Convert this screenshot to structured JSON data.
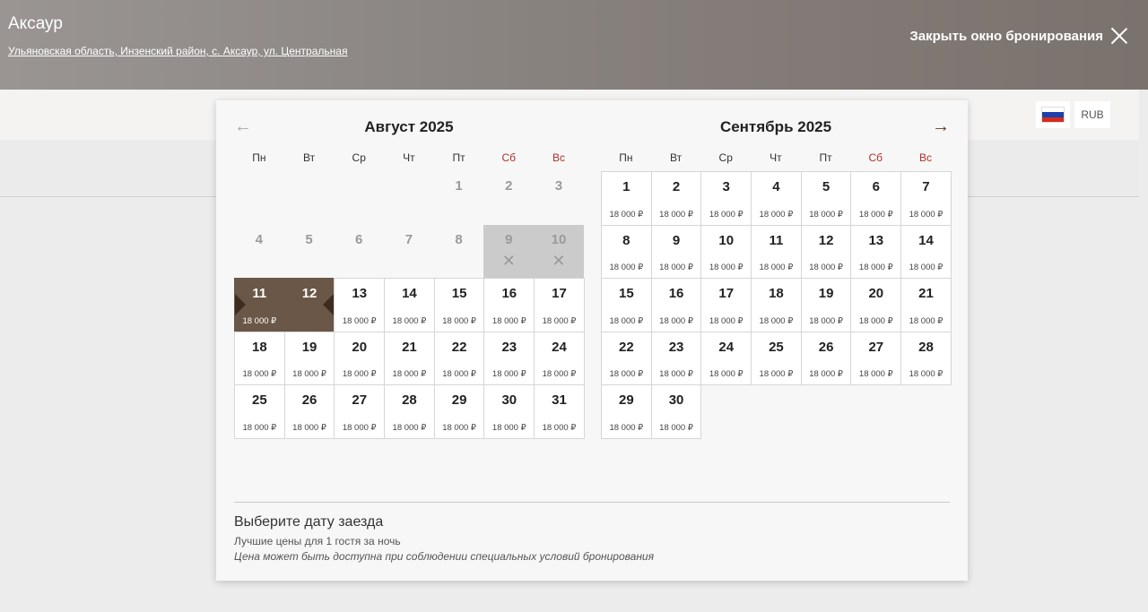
{
  "header": {
    "hotel_name": "Аксаур",
    "address": "Ульяновская область, Инзенский район, с. Аксаур, ул. Центральная",
    "close_label": "Закрыть окно бронирования"
  },
  "toolbar": {
    "currency": "RUB",
    "flag_colors": [
      "#ffffff",
      "#1c3fae",
      "#d52b1e"
    ]
  },
  "calendar": {
    "prev_arrow": "←",
    "next_arrow": "→",
    "weekdays": [
      "Пн",
      "Вт",
      "Ср",
      "Чт",
      "Пт",
      "Сб",
      "Вс"
    ],
    "months": [
      {
        "title": "Август 2025",
        "leading_blanks": 4,
        "days": [
          {
            "n": "1",
            "state": "past"
          },
          {
            "n": "2",
            "state": "past"
          },
          {
            "n": "3",
            "state": "past"
          },
          {
            "n": "4",
            "state": "past"
          },
          {
            "n": "5",
            "state": "past"
          },
          {
            "n": "6",
            "state": "past"
          },
          {
            "n": "7",
            "state": "past"
          },
          {
            "n": "8",
            "state": "past"
          },
          {
            "n": "9",
            "state": "unavailable",
            "mark": "✕"
          },
          {
            "n": "10",
            "state": "unavailable",
            "mark": "✕"
          },
          {
            "n": "11",
            "state": "selected-start",
            "price": "18 000 ₽"
          },
          {
            "n": "12",
            "state": "selected-end"
          },
          {
            "n": "13",
            "state": "available",
            "price": "18 000 ₽"
          },
          {
            "n": "14",
            "state": "available",
            "price": "18 000 ₽"
          },
          {
            "n": "15",
            "state": "available",
            "price": "18 000 ₽"
          },
          {
            "n": "16",
            "state": "available",
            "price": "18 000 ₽"
          },
          {
            "n": "17",
            "state": "available",
            "price": "18 000 ₽"
          },
          {
            "n": "18",
            "state": "available",
            "price": "18 000 ₽"
          },
          {
            "n": "19",
            "state": "available",
            "price": "18 000 ₽"
          },
          {
            "n": "20",
            "state": "available",
            "price": "18 000 ₽"
          },
          {
            "n": "21",
            "state": "available",
            "price": "18 000 ₽"
          },
          {
            "n": "22",
            "state": "available",
            "price": "18 000 ₽"
          },
          {
            "n": "23",
            "state": "available",
            "price": "18 000 ₽"
          },
          {
            "n": "24",
            "state": "available",
            "price": "18 000 ₽"
          },
          {
            "n": "25",
            "state": "available",
            "price": "18 000 ₽"
          },
          {
            "n": "26",
            "state": "available",
            "price": "18 000 ₽"
          },
          {
            "n": "27",
            "state": "available",
            "price": "18 000 ₽"
          },
          {
            "n": "28",
            "state": "available",
            "price": "18 000 ₽"
          },
          {
            "n": "29",
            "state": "available",
            "price": "18 000 ₽"
          },
          {
            "n": "30",
            "state": "available",
            "price": "18 000 ₽"
          },
          {
            "n": "31",
            "state": "available",
            "price": "18 000 ₽"
          }
        ]
      },
      {
        "title": "Сентябрь 2025",
        "leading_blanks": 0,
        "days": [
          {
            "n": "1",
            "state": "available",
            "price": "18 000 ₽"
          },
          {
            "n": "2",
            "state": "available",
            "price": "18 000 ₽"
          },
          {
            "n": "3",
            "state": "available",
            "price": "18 000 ₽"
          },
          {
            "n": "4",
            "state": "available",
            "price": "18 000 ₽"
          },
          {
            "n": "5",
            "state": "available",
            "price": "18 000 ₽"
          },
          {
            "n": "6",
            "state": "available",
            "price": "18 000 ₽"
          },
          {
            "n": "7",
            "state": "available",
            "price": "18 000 ₽"
          },
          {
            "n": "8",
            "state": "available",
            "price": "18 000 ₽"
          },
          {
            "n": "9",
            "state": "available",
            "price": "18 000 ₽"
          },
          {
            "n": "10",
            "state": "available",
            "price": "18 000 ₽"
          },
          {
            "n": "11",
            "state": "available",
            "price": "18 000 ₽"
          },
          {
            "n": "12",
            "state": "available",
            "price": "18 000 ₽"
          },
          {
            "n": "13",
            "state": "available",
            "price": "18 000 ₽"
          },
          {
            "n": "14",
            "state": "available",
            "price": "18 000 ₽"
          },
          {
            "n": "15",
            "state": "available",
            "price": "18 000 ₽"
          },
          {
            "n": "16",
            "state": "available",
            "price": "18 000 ₽"
          },
          {
            "n": "17",
            "state": "available",
            "price": "18 000 ₽"
          },
          {
            "n": "18",
            "state": "available",
            "price": "18 000 ₽"
          },
          {
            "n": "19",
            "state": "available",
            "price": "18 000 ₽"
          },
          {
            "n": "20",
            "state": "available",
            "price": "18 000 ₽"
          },
          {
            "n": "21",
            "state": "available",
            "price": "18 000 ₽"
          },
          {
            "n": "22",
            "state": "available",
            "price": "18 000 ₽"
          },
          {
            "n": "23",
            "state": "available",
            "price": "18 000 ₽"
          },
          {
            "n": "24",
            "state": "available",
            "price": "18 000 ₽"
          },
          {
            "n": "25",
            "state": "available",
            "price": "18 000 ₽"
          },
          {
            "n": "26",
            "state": "available",
            "price": "18 000 ₽"
          },
          {
            "n": "27",
            "state": "available",
            "price": "18 000 ₽"
          },
          {
            "n": "28",
            "state": "available",
            "price": "18 000 ₽"
          },
          {
            "n": "29",
            "state": "available",
            "price": "18 000 ₽"
          },
          {
            "n": "30",
            "state": "available",
            "price": "18 000 ₽"
          }
        ]
      }
    ]
  },
  "footer": {
    "title": "Выберите дату заезда",
    "subtitle": "Лучшие цены для 1 гостя за ночь",
    "note": "Цена может быть доступна при соблюдении специальных условий бронирования"
  }
}
